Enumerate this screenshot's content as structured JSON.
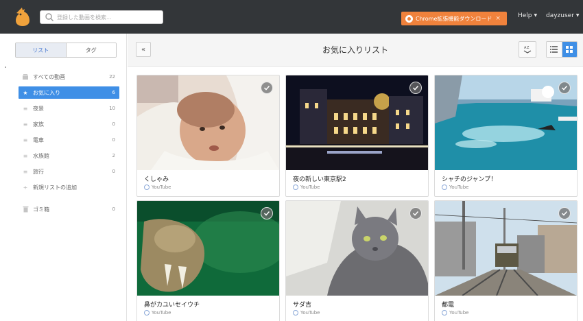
{
  "header": {
    "search_placeholder": "登録した動画を検索...",
    "extension_button": "Chrome拡張機能ダウンロード",
    "extension_close": "×",
    "help": "Help",
    "user": "dayzuser"
  },
  "sidebar": {
    "tabs": [
      "リスト",
      "タグ"
    ],
    "items": [
      {
        "label": "すべての動画",
        "count": "22"
      },
      {
        "label": "お気に入り",
        "count": "6"
      },
      {
        "label": "夜景",
        "count": "10"
      },
      {
        "label": "家族",
        "count": "0"
      },
      {
        "label": "電車",
        "count": "0"
      },
      {
        "label": "水族館",
        "count": "2"
      },
      {
        "label": "旅行",
        "count": "0"
      }
    ],
    "add_list": "新規リストの追加",
    "trash": {
      "label": "ゴミ箱",
      "count": "0"
    }
  },
  "main": {
    "title": "お気に入りリスト",
    "back": "«",
    "videos": [
      {
        "title": "くしゃみ",
        "source": "YouTube"
      },
      {
        "title": "夜の新しい東京駅2",
        "source": "YouTube"
      },
      {
        "title": "シャチのジャンプ！",
        "source": "YouTube"
      },
      {
        "title": "鼻がカユいセイウチ",
        "source": "YouTube"
      },
      {
        "title": "サダ吉",
        "source": "YouTube"
      },
      {
        "title": "都電",
        "source": "YouTube"
      }
    ]
  },
  "colors": {
    "topbar": "#333639",
    "accent": "#3f8fe6",
    "extension": "#f0823c"
  },
  "icons": [
    "bird-logo-icon",
    "search-icon",
    "chrome-icon",
    "caret-down-icon",
    "video-stack-icon",
    "star-icon",
    "list-icon",
    "plus-icon",
    "trash-icon",
    "sort-icon",
    "list-view-icon",
    "grid-view-icon",
    "check-icon",
    "youtube-icon"
  ]
}
